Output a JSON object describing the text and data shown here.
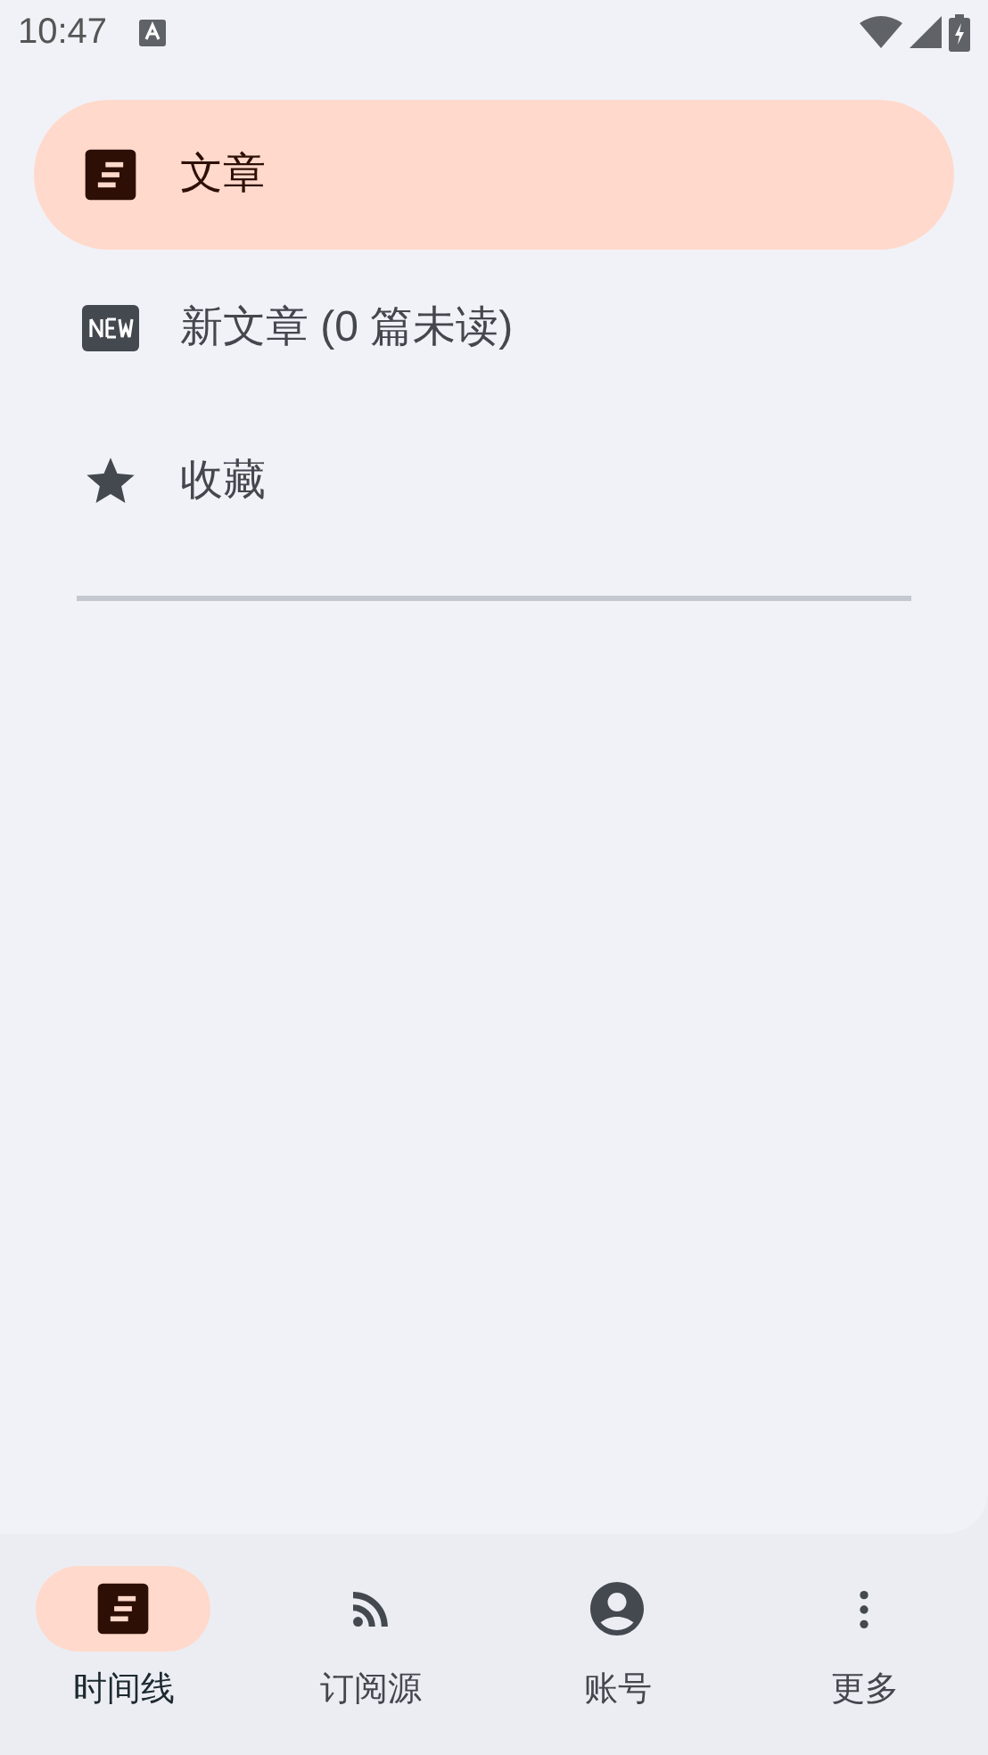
{
  "status_bar": {
    "time": "10:47"
  },
  "drawer_items": [
    {
      "kind": "article",
      "label": "文章",
      "selected": true
    },
    {
      "kind": "new",
      "label": "新文章 (0 篇未读)",
      "selected": false
    },
    {
      "kind": "star",
      "label": "收藏",
      "selected": false
    }
  ],
  "bottom_nav": [
    {
      "kind": "timeline",
      "label": "时间线",
      "selected": true
    },
    {
      "kind": "feeds",
      "label": "订阅源",
      "selected": false
    },
    {
      "kind": "account",
      "label": "账号",
      "selected": false
    },
    {
      "kind": "more",
      "label": "更多",
      "selected": false
    }
  ]
}
